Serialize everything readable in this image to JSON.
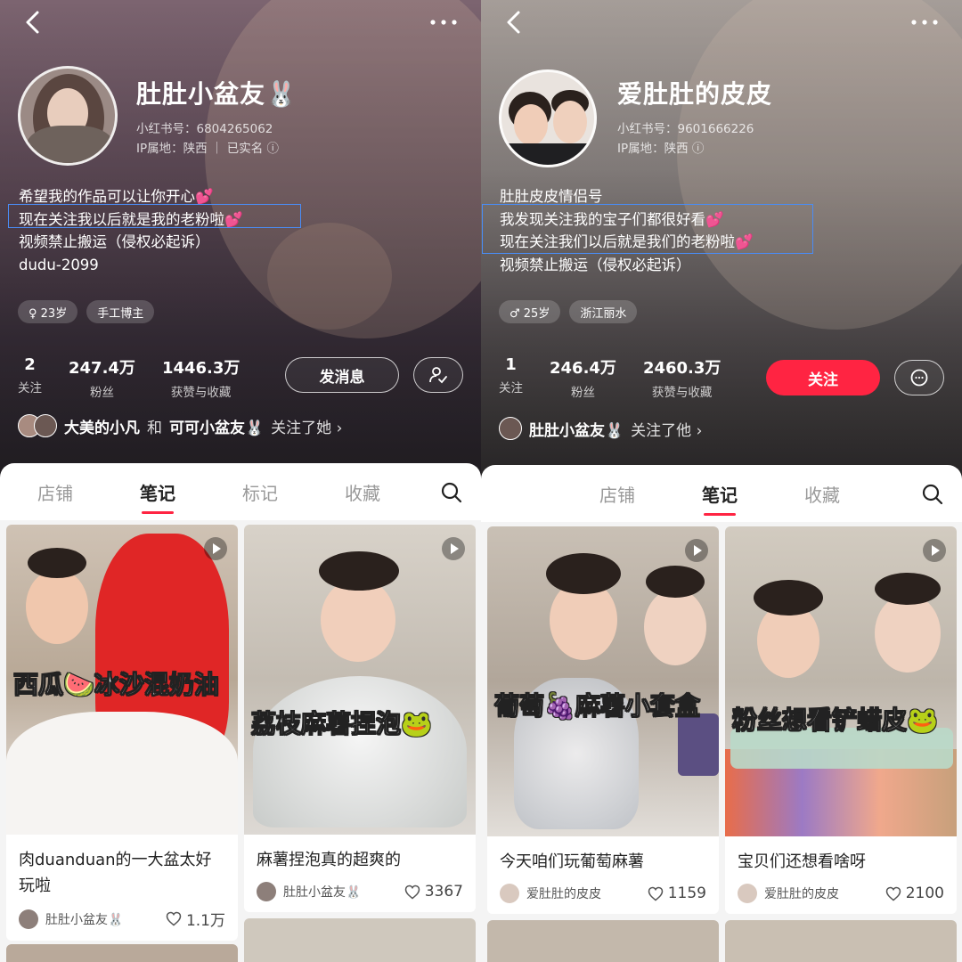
{
  "left": {
    "name": "肚肚小盆友🐰",
    "id": "小红书号：6804265062",
    "ip": "IP属地：陕西 ｜ 已实名 ⓘ",
    "bio": [
      "希望我的作品可以让你开心💕",
      "现在关注我以后就是我的老粉啦💕",
      "视频禁止搬运（侵权必起诉）",
      "dudu-2099"
    ],
    "tags": [
      "♀ 23岁",
      "手工博主"
    ],
    "stats": [
      {
        "v": "2",
        "l": "关注"
      },
      {
        "v": "247.4万",
        "l": "粉丝"
      },
      {
        "v": "1446.3万",
        "l": "获赞与收藏"
      }
    ],
    "action_button": "发消息",
    "followed": {
      "names": [
        "大美的小凡",
        "可可小盆友🐰"
      ],
      "and": "和",
      "rest": "关注了她 ›"
    },
    "tabs": [
      "店铺",
      "笔记",
      "标记",
      "收藏"
    ],
    "active_tab": "笔记",
    "cards": [
      {
        "cover_text": "西瓜🍉冰沙混奶油",
        "title": "肉duanduan的一大盆太好玩啦",
        "author": "肚肚小盆友🐰",
        "likes": "1.1万"
      },
      {
        "cover_text": "荔枝麻薯捏泡🐸",
        "title": "麻薯捏泡真的超爽的",
        "author": "肚肚小盆友🐰",
        "likes": "3367"
      }
    ]
  },
  "right": {
    "name": "爱肚肚的皮皮",
    "id": "小红书号：9601666226",
    "ip": "IP属地：陕西 ⓘ",
    "bio": [
      "肚肚皮皮情侣号",
      "我发现关注我的宝子们都很好看💕",
      "现在关注我们以后就是我们的老粉啦💕",
      "视频禁止搬运（侵权必起诉）"
    ],
    "tags": [
      "♂ 25岁",
      "浙江丽水"
    ],
    "stats": [
      {
        "v": "1",
        "l": "关注"
      },
      {
        "v": "246.4万",
        "l": "粉丝"
      },
      {
        "v": "2460.3万",
        "l": "获赞与收藏"
      }
    ],
    "action_button": "关注",
    "followed": {
      "names": [
        "肚肚小盆友🐰"
      ],
      "rest": "关注了他 ›"
    },
    "tabs": [
      "店铺",
      "笔记",
      "收藏"
    ],
    "active_tab": "笔记",
    "cards": [
      {
        "cover_text": "葡萄🍇麻薯小套盒",
        "title": "今天咱们玩葡萄麻薯",
        "author": "爱肚肚的皮皮",
        "likes": "1159"
      },
      {
        "cover_text": "粉丝想看铲蜡皮🐸",
        "title": "宝贝们还想看啥呀",
        "author": "爱肚肚的皮皮",
        "likes": "2100"
      }
    ]
  },
  "colors": {
    "accent": "#ff2442",
    "highlight_box": "#4a8cf5"
  }
}
